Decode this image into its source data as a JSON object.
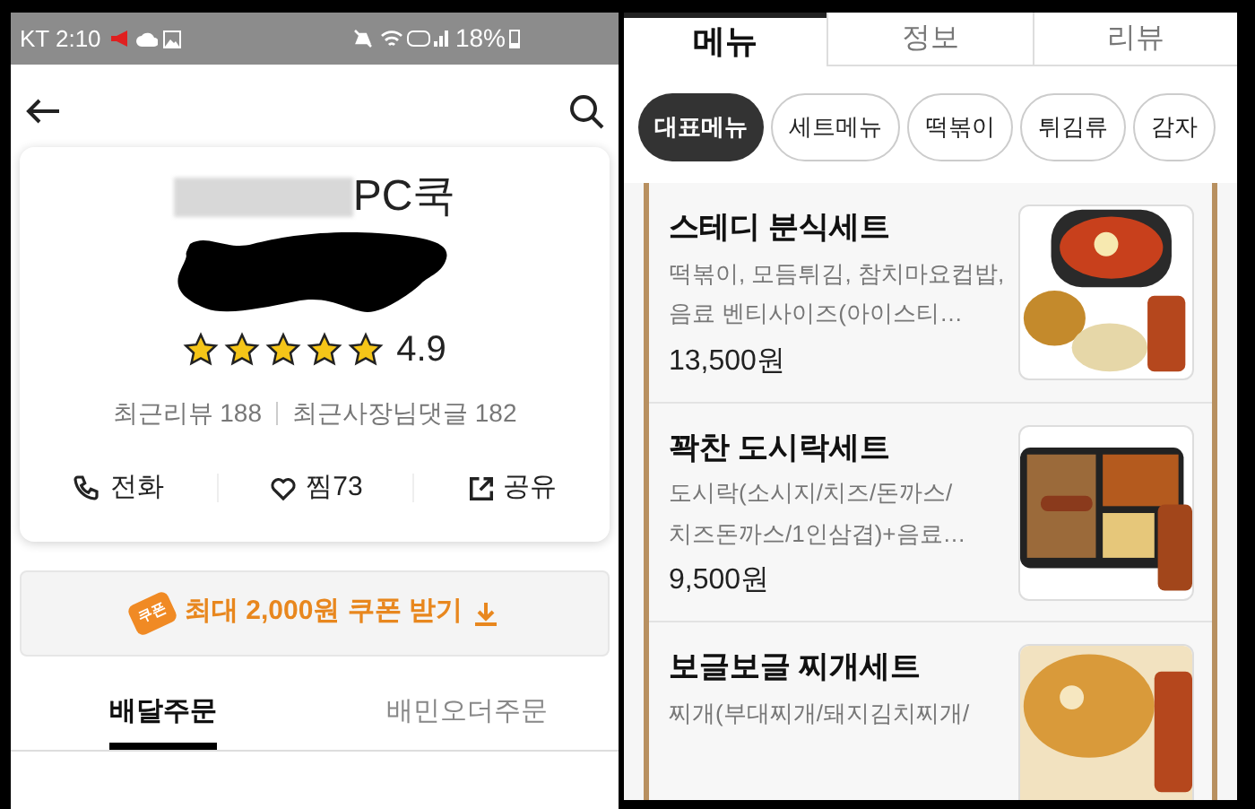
{
  "status_bar": {
    "carrier_time": "KT 2:10",
    "battery": "18%"
  },
  "store": {
    "name": "PC쿡",
    "rating": "4.9",
    "stars": 5,
    "recent_reviews": "최근리뷰 188",
    "owner_replies": "최근사장님댓글 182"
  },
  "actions": [
    {
      "kind": "phone",
      "label": "전화"
    },
    {
      "kind": "heart",
      "label": "찜73"
    },
    {
      "kind": "share",
      "label": "공유"
    }
  ],
  "coupon": {
    "badge": "쿠폰",
    "label": "최대 2,000원 쿠폰 받기"
  },
  "order_tabs": [
    {
      "label": "배달주문",
      "selected": true
    },
    {
      "label": "배민오더주문",
      "selected": false
    }
  ],
  "main_tabs": [
    {
      "label": "메뉴",
      "selected": true
    },
    {
      "label": "정보",
      "selected": false
    },
    {
      "label": "리뷰",
      "selected": false
    }
  ],
  "chips": [
    {
      "label": "대표메뉴",
      "selected": true
    },
    {
      "label": "세트메뉴",
      "selected": false
    },
    {
      "label": "떡볶이",
      "selected": false
    },
    {
      "label": "튀김류",
      "selected": false
    },
    {
      "label": "감자",
      "selected": false
    }
  ],
  "menu_items": [
    {
      "name": "스테디 분식세트",
      "description_lines": [
        "떡볶이, 모듬튀김, 참치마요컵밥,",
        "음료 벤티사이즈(아이스티…"
      ],
      "price": "13,500원",
      "kind": "picture"
    },
    {
      "name": "꽉찬 도시락세트",
      "description_lines": [
        "도시락(소시지/치즈/돈까스/",
        "치즈돈까스/1인삼겹)+음료…"
      ],
      "price": "9,500원",
      "kind": "picture"
    },
    {
      "name": "보글보글 찌개세트",
      "description_lines": [
        "찌개(부대찌개/돼지김치찌개/"
      ],
      "kind": "picture"
    }
  ]
}
